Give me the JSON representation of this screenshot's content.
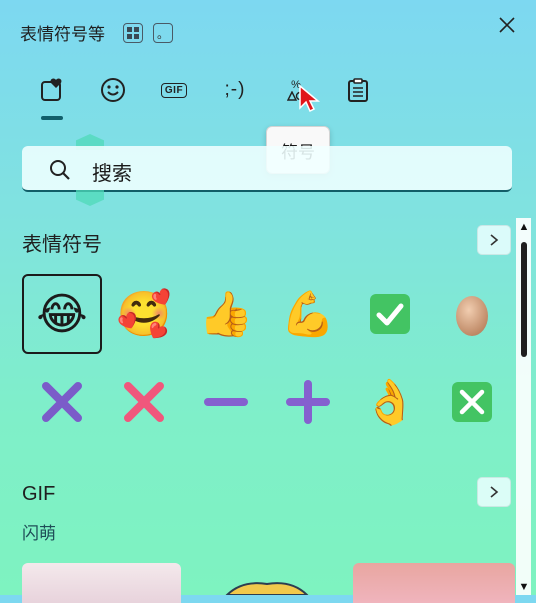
{
  "window": {
    "title": "表情符号等",
    "kbd_hint_1": "⊞",
    "kbd_hint_2": "。",
    "close_icon": "close-icon"
  },
  "tabs": [
    {
      "name": "tab-emoji-favorites",
      "icon": "heart-in-square-icon",
      "selected": true
    },
    {
      "name": "tab-emoji",
      "icon": "smiley-icon"
    },
    {
      "name": "tab-gif",
      "label": "GIF"
    },
    {
      "name": "tab-kaomoji",
      "label": ";-)"
    },
    {
      "name": "tab-symbols",
      "label": "%",
      "icon": "symbols-icon"
    },
    {
      "name": "tab-clipboard",
      "icon": "clipboard-icon"
    }
  ],
  "tooltip": {
    "text": "符号"
  },
  "search": {
    "placeholder": "搜索"
  },
  "emoji_section": {
    "title": "表情符号",
    "items": [
      [
        "😂",
        "🥰",
        "👍",
        "💪",
        "✅",
        "🥚"
      ],
      [
        "✖",
        "❌",
        "➖",
        "➕",
        "👌",
        "❎"
      ]
    ]
  },
  "gif_section": {
    "title": "GIF",
    "subtitle": "闪萌"
  },
  "colors": {
    "accent": "#115f6b",
    "gradient_top": "#7dd8f1",
    "gradient_bottom": "#7ef3c0"
  }
}
